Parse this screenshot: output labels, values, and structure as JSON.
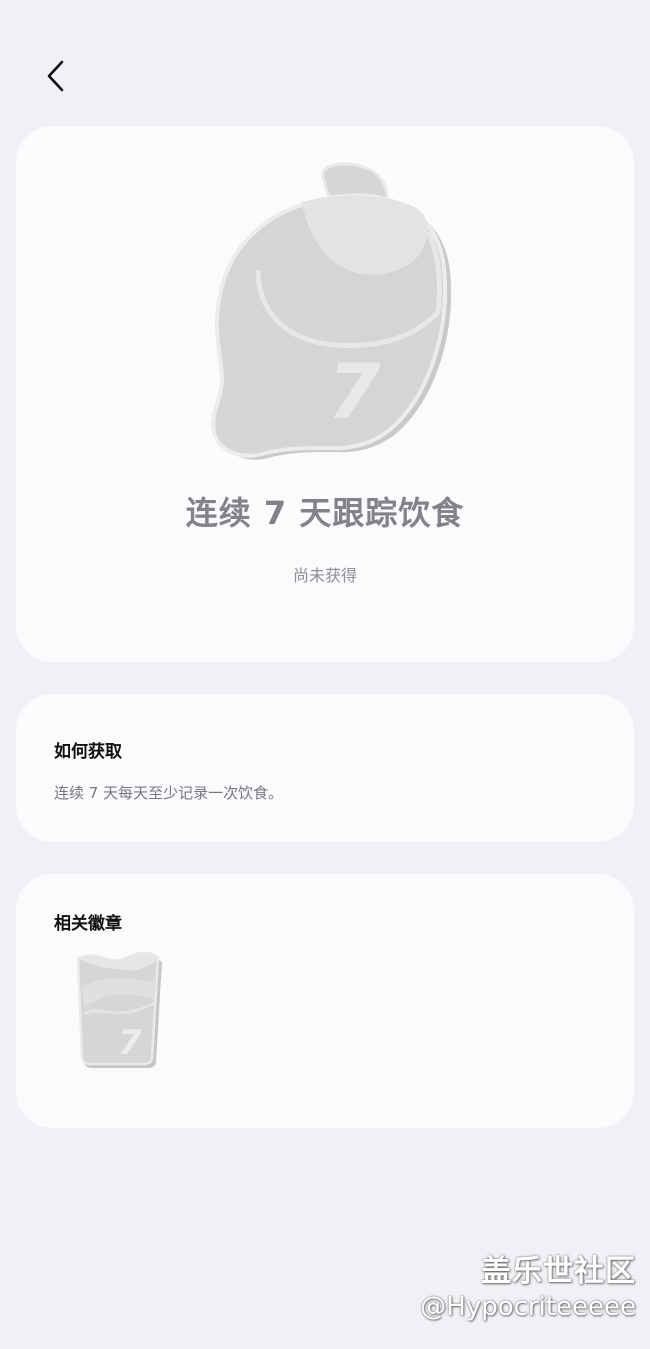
{
  "header": {
    "back_icon": "chevron-left-icon"
  },
  "badge": {
    "title": "连续 7 天跟踪饮食",
    "number": "7",
    "status": "尚未获得",
    "icon": "lemon-badge-icon",
    "state": "locked"
  },
  "how_to_get": {
    "title": "如何获取",
    "description": "连续 7 天每天至少记录一次饮食。"
  },
  "related": {
    "title": "相关徽章",
    "items": [
      {
        "icon": "cup-badge-icon",
        "number": "7",
        "state": "locked"
      }
    ]
  },
  "watermark": {
    "community": "盖乐世社区",
    "user": "@Hypocriteeeee"
  },
  "colors": {
    "background": "#f1f0f5",
    "card": "#fbfbfe",
    "badge_title": "#828287",
    "badge_gray": "#d4d4d4"
  }
}
